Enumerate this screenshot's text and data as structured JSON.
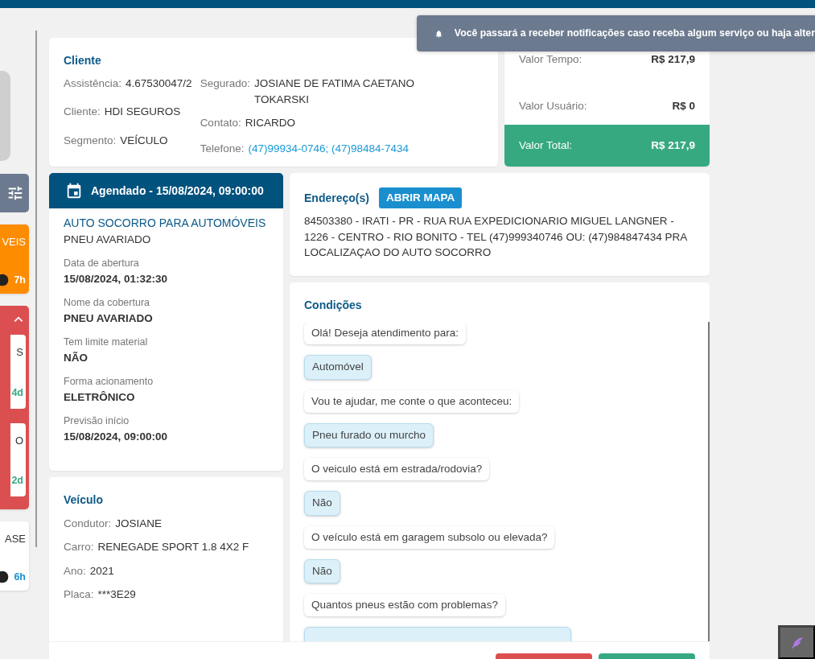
{
  "notification": {
    "text": "Você passará a receber notificações caso receba algum serviço ou haja alter"
  },
  "sidebar": {
    "cards": [
      {
        "color": "#fd8c00",
        "title": "VEIS",
        "time": "7h"
      },
      {
        "color": "#dc4f51",
        "expanded": true,
        "children": [
          {
            "title": "S",
            "time": "4d"
          },
          {
            "title": "O",
            "time": "2d"
          }
        ]
      },
      {
        "color": "#ffffff",
        "title": "ASE",
        "time": "6h"
      }
    ]
  },
  "client": {
    "title": "Cliente",
    "columns": [
      [
        {
          "label": "Assistência:",
          "value": "4.67530047/2"
        },
        {
          "label": "Cliente:",
          "value": "HDI SEGUROS"
        },
        {
          "label": "Segmento:",
          "value": "VEÍCULO"
        }
      ],
      [
        {
          "label": "Segurado:",
          "value": "JOSIANE DE FATIMA CAETANO TOKARSKI"
        },
        {
          "label": "Contato:",
          "value": "RICARDO"
        },
        {
          "label": "Telefone:",
          "value": "(47)99934-0746; (47)98484-7434",
          "kind": "link"
        }
      ]
    ]
  },
  "values": {
    "rows": [
      {
        "label": "Valor Tempo:",
        "value": "R$ 217,9"
      },
      {
        "label": "Valor Usuário:",
        "value": "R$ 0"
      }
    ],
    "total": {
      "label": "Valor Total:",
      "value": "R$ 217,9"
    }
  },
  "schedule": {
    "header": "Agendado - 15/08/2024, 09:00:00",
    "service": "AUTO SOCORRO PARA AUTOMÓVEIS",
    "problem": "PNEU AVARIADO",
    "fields": [
      {
        "label": "Data de abertura",
        "value": "15/08/2024, 01:32:30"
      },
      {
        "label": "Nome da cobertura",
        "value": "PNEU AVARIADO"
      },
      {
        "label": "Tem limite material",
        "value": "NÃO"
      },
      {
        "label": "Forma acionamento",
        "value": "ELETRÔNICO"
      },
      {
        "label": "Previsão início",
        "value": "15/08/2024, 09:00:00"
      }
    ]
  },
  "vehicle": {
    "title": "Veículo",
    "fields": [
      {
        "label": "Condutor:",
        "value": "JOSIANE"
      },
      {
        "label": "Carro:",
        "value": "RENEGADE SPORT 1.8 4X2 F"
      },
      {
        "label": "Ano:",
        "value": "2021"
      },
      {
        "label": "Placa:",
        "value": "***3E29"
      }
    ]
  },
  "address": {
    "title": "Endereço(s)",
    "button": "ABRIR MAPA",
    "text": "84503380 - IRATI - PR - RUA RUA EXPEDICIONARIO MIGUEL LANGNER - 1226 - CENTRO - RIO BONITO - TEL (47)999340746 OU: (47)984847434 PRA LOCALIZAÇAO DO AUTO SOCORRO"
  },
  "conditions": {
    "title": "Condições",
    "messages": [
      {
        "kind": "question",
        "text": "Olá! Deseja atendimento para:"
      },
      {
        "kind": "answer",
        "text": "Automóvel"
      },
      {
        "kind": "question",
        "text": "Vou te ajudar, me conte o que aconteceu:"
      },
      {
        "kind": "answer",
        "text": "Pneu furado ou murcho"
      },
      {
        "kind": "question",
        "text": "O veiculo está em estrada/rodovia?"
      },
      {
        "kind": "answer",
        "text": "Não"
      },
      {
        "kind": "question",
        "text": "O veículo está em garagem subsolo ou elevada?"
      },
      {
        "kind": "answer",
        "text": "Não"
      },
      {
        "kind": "question",
        "text": "Quantos pneus estão com problemas?"
      },
      {
        "kind": "answer"
      }
    ]
  },
  "footer": {
    "buttons": [
      {
        "kind": "danger"
      },
      {
        "kind": "success"
      }
    ]
  }
}
